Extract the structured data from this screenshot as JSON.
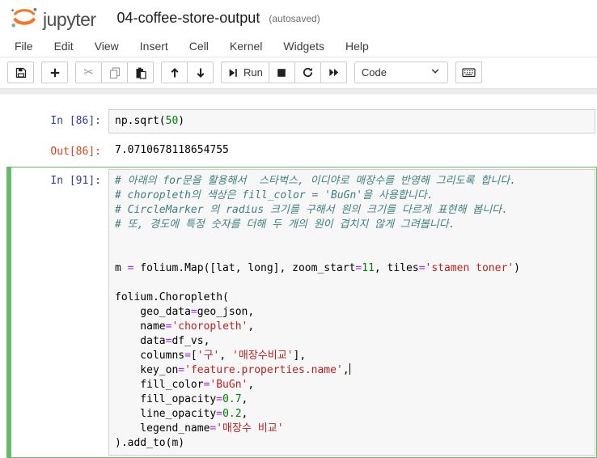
{
  "header": {
    "wordmark": "jupyter",
    "title": "04-coffee-store-output",
    "autosave_status": "(autosaved)"
  },
  "menu": {
    "items": [
      {
        "id": "file",
        "label": "File"
      },
      {
        "id": "edit",
        "label": "Edit"
      },
      {
        "id": "view",
        "label": "View"
      },
      {
        "id": "insert",
        "label": "Insert"
      },
      {
        "id": "cell",
        "label": "Cell"
      },
      {
        "id": "kernel",
        "label": "Kernel"
      },
      {
        "id": "widgets",
        "label": "Widgets"
      },
      {
        "id": "help",
        "label": "Help"
      }
    ]
  },
  "toolbar": {
    "groups": [
      {
        "buttons": [
          {
            "name": "save-button",
            "icon": "save-icon"
          }
        ]
      },
      {
        "buttons": [
          {
            "name": "add-cell-button",
            "icon": "add-cell-icon"
          }
        ]
      },
      {
        "buttons": [
          {
            "name": "cut-cell-button",
            "icon": "cut-icon"
          },
          {
            "name": "copy-cell-button",
            "icon": "copy-icon"
          },
          {
            "name": "paste-cell-button",
            "icon": "paste-icon"
          }
        ]
      },
      {
        "buttons": [
          {
            "name": "move-cell-up-button",
            "icon": "move-up-icon"
          },
          {
            "name": "move-cell-down-button",
            "icon": "move-down-icon"
          }
        ]
      },
      {
        "buttons": [
          {
            "name": "run-button",
            "icon": "run-icon",
            "label": "Run"
          },
          {
            "name": "interrupt-kernel-button",
            "icon": "stop-icon"
          },
          {
            "name": "restart-kernel-button",
            "icon": "restart-icon"
          },
          {
            "name": "restart-run-all-button",
            "icon": "fast-forward-icon"
          }
        ]
      }
    ],
    "cell_type_value": "Code",
    "keyboard_button": {
      "name": "command-palette-button",
      "icon": "keyboard-icon"
    }
  },
  "colors": {
    "logo_orange": "#F37726",
    "selected_cell_green": "#66BB6A",
    "in_prompt": "#303F9F",
    "out_prompt": "#D84315",
    "comment": "#408080",
    "operator": "#AA22FF",
    "number": "#008000",
    "string": "#BA2121"
  },
  "cells": [
    {
      "selected": false,
      "in_prompt": "In [86]:",
      "lines": [
        [
          {
            "t": "plain",
            "v": "np.sqrt("
          },
          {
            "t": "number",
            "v": "50"
          },
          {
            "t": "plain",
            "v": ")"
          }
        ]
      ],
      "out_prompt": "Out[86]:",
      "output": "7.0710678118654755"
    },
    {
      "selected": true,
      "in_prompt": "In [91]:",
      "lines": [
        [
          {
            "t": "comment",
            "v": "# 아래의 for문을 활용해서  스타벅스, 이디야로 매장수를 반영해 그리도록 합니다."
          }
        ],
        [
          {
            "t": "comment",
            "v": "# choropleth의 색상은 fill_color = 'BuGn'을 사용합니다."
          }
        ],
        [
          {
            "t": "comment",
            "v": "# CircleMarker 의 radius 크기를 구해서 원의 크기를 다르게 표현해 봅니다."
          }
        ],
        [
          {
            "t": "comment",
            "v": "# 또, 경도에 특정 숫자를 더해 두 개의 원이 겹치지 않게 그려봅니다."
          }
        ],
        [],
        [],
        [
          {
            "t": "plain",
            "v": "m "
          },
          {
            "t": "operator",
            "v": "="
          },
          {
            "t": "plain",
            "v": " folium.Map([lat, long], zoom_start"
          },
          {
            "t": "operator",
            "v": "="
          },
          {
            "t": "number",
            "v": "11"
          },
          {
            "t": "plain",
            "v": ", tiles"
          },
          {
            "t": "operator",
            "v": "="
          },
          {
            "t": "string",
            "v": "'stamen toner'"
          },
          {
            "t": "plain",
            "v": ")"
          }
        ],
        [],
        [
          {
            "t": "plain",
            "v": "folium.Choropleth("
          }
        ],
        [
          {
            "t": "plain",
            "v": "    geo_data"
          },
          {
            "t": "operator",
            "v": "="
          },
          {
            "t": "plain",
            "v": "geo_json,"
          }
        ],
        [
          {
            "t": "plain",
            "v": "    name"
          },
          {
            "t": "operator",
            "v": "="
          },
          {
            "t": "string",
            "v": "'choropleth'"
          },
          {
            "t": "plain",
            "v": ","
          }
        ],
        [
          {
            "t": "plain",
            "v": "    data"
          },
          {
            "t": "operator",
            "v": "="
          },
          {
            "t": "plain",
            "v": "df_vs,"
          }
        ],
        [
          {
            "t": "plain",
            "v": "    columns"
          },
          {
            "t": "operator",
            "v": "="
          },
          {
            "t": "plain",
            "v": "["
          },
          {
            "t": "string",
            "v": "'구'"
          },
          {
            "t": "plain",
            "v": ", "
          },
          {
            "t": "string",
            "v": "'매장수비교'"
          },
          {
            "t": "plain",
            "v": "],"
          }
        ],
        [
          {
            "t": "plain",
            "v": "    key_on"
          },
          {
            "t": "operator",
            "v": "="
          },
          {
            "t": "string",
            "v": "'feature.properties.name'"
          },
          {
            "t": "plain",
            "v": ","
          },
          {
            "t": "cursor"
          }
        ],
        [
          {
            "t": "plain",
            "v": "    fill_color"
          },
          {
            "t": "operator",
            "v": "="
          },
          {
            "t": "string",
            "v": "'BuGn'"
          },
          {
            "t": "plain",
            "v": ","
          }
        ],
        [
          {
            "t": "plain",
            "v": "    fill_opacity"
          },
          {
            "t": "operator",
            "v": "="
          },
          {
            "t": "number",
            "v": "0.7"
          },
          {
            "t": "plain",
            "v": ","
          }
        ],
        [
          {
            "t": "plain",
            "v": "    line_opacity"
          },
          {
            "t": "operator",
            "v": "="
          },
          {
            "t": "number",
            "v": "0.2"
          },
          {
            "t": "plain",
            "v": ","
          }
        ],
        [
          {
            "t": "plain",
            "v": "    legend_name"
          },
          {
            "t": "operator",
            "v": "="
          },
          {
            "t": "string",
            "v": "'매장수 비교'"
          }
        ],
        [
          {
            "t": "plain",
            "v": ").add_to(m)"
          }
        ]
      ]
    }
  ]
}
